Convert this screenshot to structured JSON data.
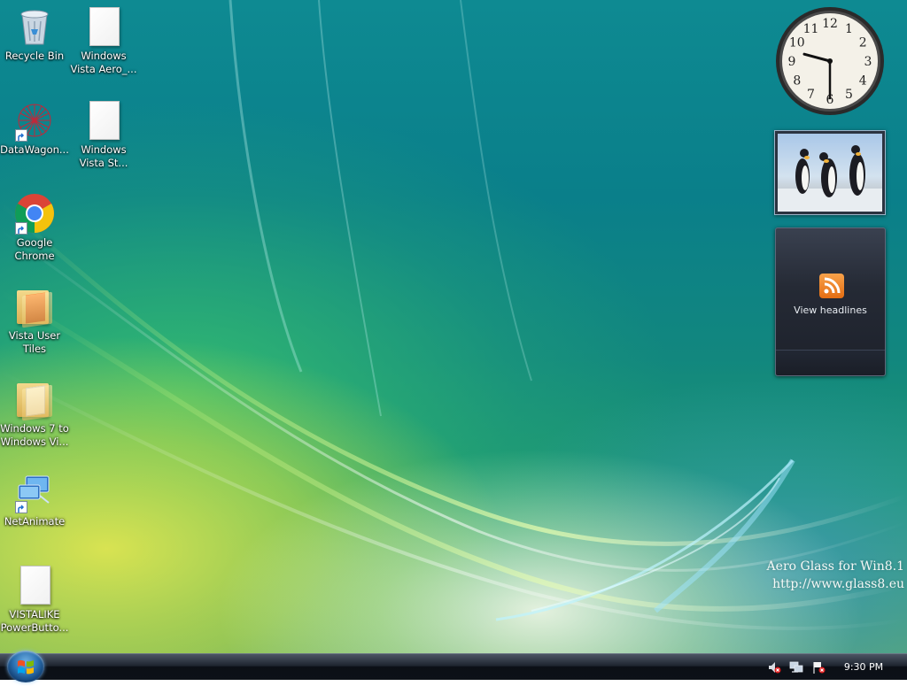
{
  "desktop_icons": [
    {
      "label": "Recycle Bin",
      "icon": "recycle-bin-icon"
    },
    {
      "label": "Windows Vista Aero_...",
      "icon": "document-icon"
    },
    {
      "label": "DataWagon...",
      "icon": "datawagon-icon",
      "shortcut": true
    },
    {
      "label": "Windows Vista St...",
      "icon": "document-icon"
    },
    {
      "label": "Google Chrome",
      "icon": "chrome-icon",
      "shortcut": true
    },
    {
      "label": "Vista User Tiles",
      "icon": "folder-icon"
    },
    {
      "label": "Windows 7 to Windows Vi...",
      "icon": "folder-icon"
    },
    {
      "label": "NetAnimate",
      "icon": "network-icon",
      "shortcut": true
    },
    {
      "label": "VISTALIKE PowerButto...",
      "icon": "document-icon"
    }
  ],
  "icon_labels": {
    "recycle_bin": "Recycle Bin",
    "vista_aero_line1": "Windows",
    "vista_aero_line2": "Vista Aero_...",
    "datawagon": "DataWagon...",
    "vista_st_line1": "Windows",
    "vista_st_line2": "Vista St...",
    "chrome_line1": "Google",
    "chrome_line2": "Chrome",
    "user_tiles_line1": "Vista User",
    "user_tiles_line2": "Tiles",
    "win7_line1": "Windows 7 to",
    "win7_line2": "Windows Vi...",
    "netanimate": "NetAnimate",
    "powerbutton_line1": "VISTALIKE",
    "powerbutton_line2": "PowerButto..."
  },
  "gadgets": {
    "clock": {
      "numerals": [
        "12",
        "1",
        "2",
        "3",
        "4",
        "5",
        "6",
        "7",
        "8",
        "9",
        "10",
        "11"
      ],
      "time": "9:30"
    },
    "slideshow": {
      "subject": "penguins photo"
    },
    "feed": {
      "label": "View headlines",
      "icon": "rss-icon"
    }
  },
  "watermark": {
    "line1": "Aero Glass for Win8.1",
    "line2": "http://www.glass8.eu"
  },
  "taskbar": {
    "start_icon": "windows-logo-icon",
    "tray_icons": [
      "volume-muted-icon",
      "network-icon",
      "action-center-flag-icon"
    ],
    "clock": "9:30 PM"
  },
  "colors": {
    "taskbar": "#0d1118",
    "desktop_teal": "#0e8a92",
    "desktop_yellow": "#e1e650",
    "rss_orange": "#e46d12"
  }
}
